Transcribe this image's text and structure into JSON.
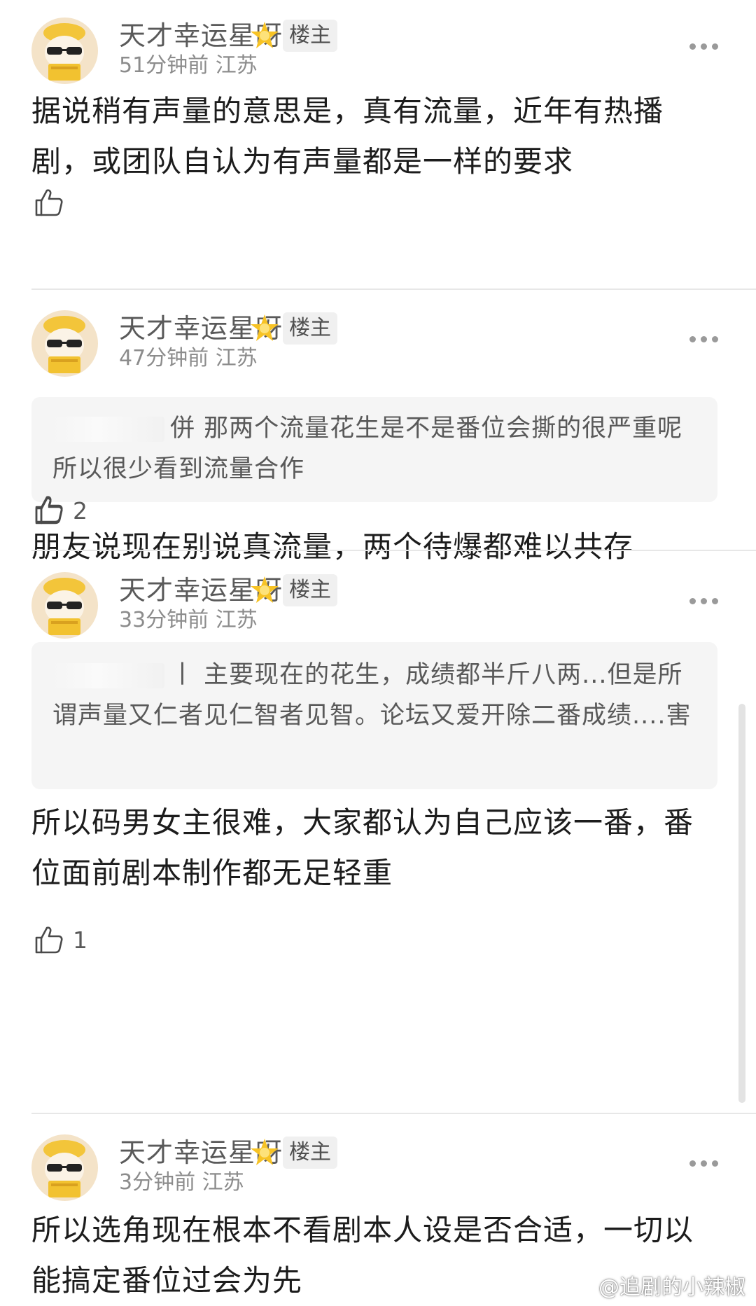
{
  "thread": {
    "comments": [
      {
        "username": "天才幸运星呀",
        "op_badge": "楼主",
        "time": "51分钟前",
        "location": "江苏",
        "quote_prefix": "",
        "quote": "",
        "body": "据说稍有声量的意思是，真有流量，近年有热播剧，或团队自认为有声量都是一样的要求",
        "likes": ""
      },
      {
        "username": "天才幸运星呀",
        "op_badge": "楼主",
        "time": "47分钟前",
        "location": "江苏",
        "quote_prefix": "併",
        "quote": "那两个流量花生是不是番位会撕的很严重呢 所以很少看到流量合作",
        "body": "朋友说现在别说真流量，两个待爆都难以共存",
        "likes": "2"
      },
      {
        "username": "天才幸运星呀",
        "op_badge": "楼主",
        "time": "33分钟前",
        "location": "江苏",
        "quote_prefix": "丨",
        "quote": "主要现在的花生，成绩都半斤八两...但是所谓声量又仁者见仁智者见智。论坛又爱开除二番成绩....害",
        "body": "所以码男女主很难，大家都认为自己应该一番，番位面前剧本制作都无足轻重",
        "likes": "1"
      },
      {
        "username": "天才幸运星呀",
        "op_badge": "楼主",
        "time": "3分钟前",
        "location": "江苏",
        "quote_prefix": "",
        "quote": "",
        "body": "所以选角现在根本不看剧本人设是否合适，一切以能搞定番位过会为先",
        "likes": ""
      }
    ]
  },
  "watermark": {
    "text": "@追剧的小辣椒"
  },
  "icons": {
    "avatar": "cat-avatar-icon",
    "star": "star-emoji-icon",
    "like": "thumbs-up-icon",
    "more": "more-dots-icon",
    "watermark": "weibo-logo-icon"
  },
  "colors": {
    "username": "#5a5a5a",
    "meta": "#8c8c8c",
    "body": "#1c1c1c",
    "quote_bg": "#f5f5f5",
    "badge_bg": "#f0f0f0"
  }
}
